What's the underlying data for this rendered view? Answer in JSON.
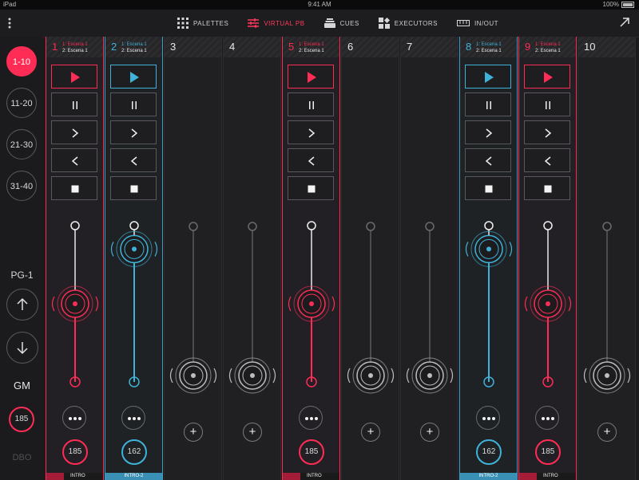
{
  "statusbar": {
    "device": "iPad",
    "time": "9:41 AM",
    "battery": "100%"
  },
  "toolbar": {
    "tabs": [
      {
        "label": "PALETTES",
        "icon": "grid-icon"
      },
      {
        "label": "VIRTUAL PB",
        "icon": "sliders-icon",
        "active": true
      },
      {
        "label": "CUES",
        "icon": "stack-icon"
      },
      {
        "label": "EXECUTORS",
        "icon": "executors-icon"
      },
      {
        "label": "IN/OUT",
        "icon": "inout-icon"
      }
    ]
  },
  "sidebar": {
    "banks": [
      "1-10",
      "11-20",
      "21-30",
      "31-40"
    ],
    "active_bank": "1-10",
    "page_label": "PG-1",
    "gm_label": "GM",
    "gm_value": "185",
    "dbo_label": "DBO"
  },
  "accent_colors": {
    "pink": "#ff2c55",
    "blue": "#3fb2d9"
  },
  "playbacks": [
    {
      "num": "1",
      "state": "pink",
      "cue_current": "1: Escena 1",
      "cue_next": "2: Escena 1",
      "level": "185",
      "footer": "INTRO",
      "fader_fraction": 0.5
    },
    {
      "num": "2",
      "state": "blue",
      "cue_current": "1: Escena 1",
      "cue_next": "2: Escena 1",
      "level": "162",
      "footer": "INTRO-2",
      "fader_fraction": 0.85
    },
    {
      "num": "3",
      "state": "empty",
      "fader_fraction": 0.0
    },
    {
      "num": "4",
      "state": "empty",
      "fader_fraction": 0.0
    },
    {
      "num": "5",
      "state": "pink",
      "cue_current": "1: Escena 1",
      "cue_next": "2: Escena 1",
      "level": "185",
      "footer": "INTRO",
      "fader_fraction": 0.5
    },
    {
      "num": "6",
      "state": "empty",
      "fader_fraction": 0.0
    },
    {
      "num": "7",
      "state": "empty",
      "fader_fraction": 0.0
    },
    {
      "num": "8",
      "state": "blue",
      "cue_current": "1: Escena 1",
      "cue_next": "2: Escena 1",
      "level": "162",
      "footer": "INTRO-2",
      "fader_fraction": 0.85
    },
    {
      "num": "9",
      "state": "pink",
      "cue_current": "1: Escena 1",
      "cue_next": "2: Escena 1",
      "level": "185",
      "footer": "INTRO",
      "fader_fraction": 0.5
    },
    {
      "num": "10",
      "state": "empty",
      "fader_fraction": 0.0
    }
  ]
}
